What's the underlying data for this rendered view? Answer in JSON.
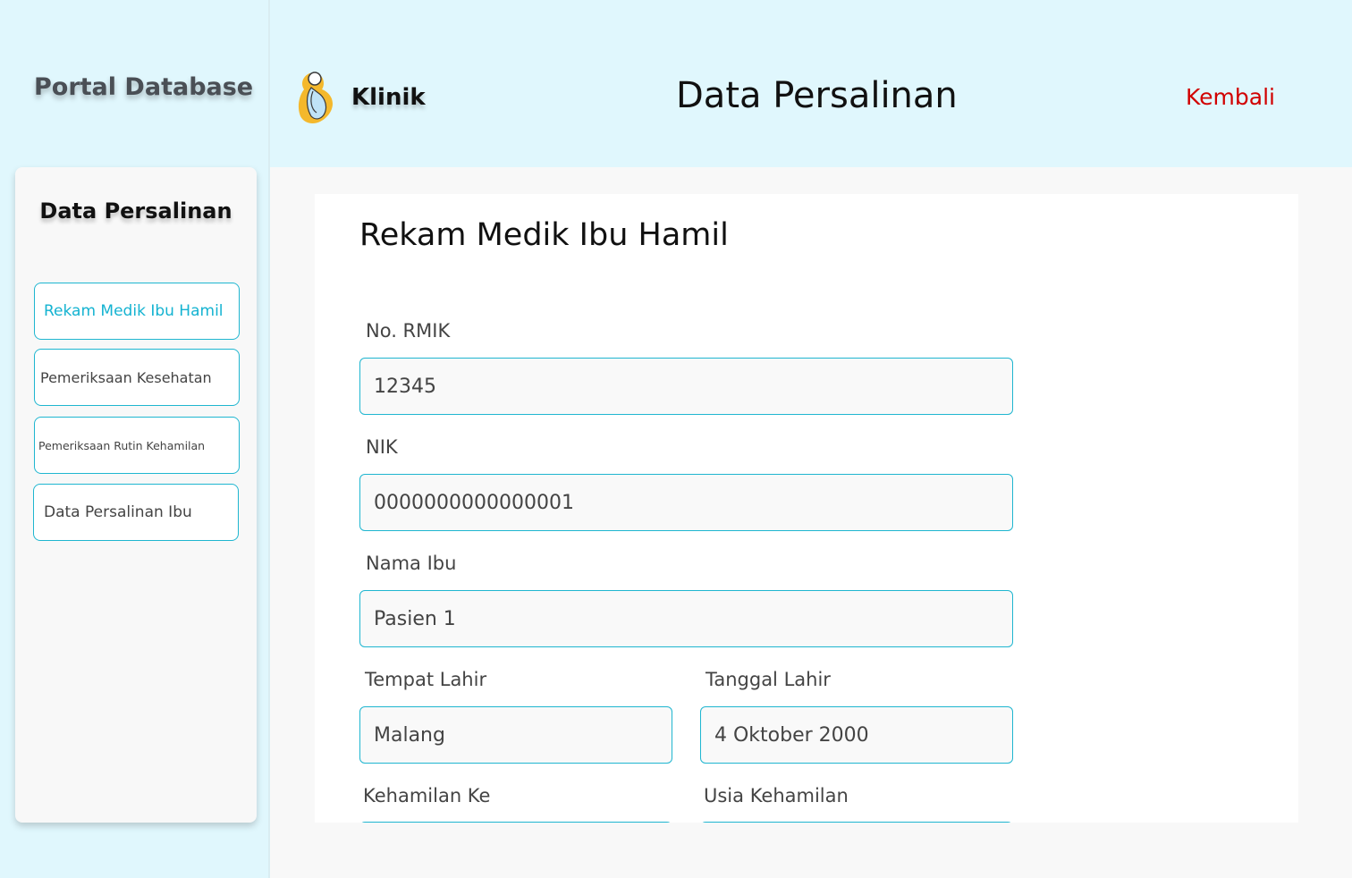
{
  "sidebar": {
    "portal_title": "Portal Database",
    "card_title": "Data Persalinan",
    "items": [
      {
        "label": "Rekam Medik Ibu Hamil",
        "active": true
      },
      {
        "label": "Pemeriksaan Kesehatan",
        "active": false
      },
      {
        "label": "Pemeriksaan Rutin Kehamilan",
        "active": false
      },
      {
        "label": "Data Persalinan Ibu",
        "active": false
      }
    ]
  },
  "header": {
    "brand": "Klinik",
    "title": "Data Persalinan",
    "back_label": "Kembali"
  },
  "form": {
    "title": "Rekam Medik Ibu Hamil",
    "fields": {
      "no_rmik": {
        "label": "No. RMIK",
        "value": "12345"
      },
      "nik": {
        "label": "NIK",
        "value": "0000000000000001"
      },
      "nama_ibu": {
        "label": "Nama Ibu",
        "value": "Pasien 1"
      },
      "tempat_lahir": {
        "label": "Tempat Lahir",
        "value": "Malang"
      },
      "tanggal_lahir": {
        "label": "Tanggal Lahir",
        "value": "4 Oktober 2000"
      },
      "kehamilan_ke": {
        "label": "Kehamilan Ke",
        "value": ""
      },
      "usia_kehamilan": {
        "label": "Usia Kehamilan",
        "value": ""
      }
    }
  },
  "colors": {
    "accent": "#14b3d1",
    "header_bg": "#e0f7fd",
    "back_link": "#d10000"
  }
}
